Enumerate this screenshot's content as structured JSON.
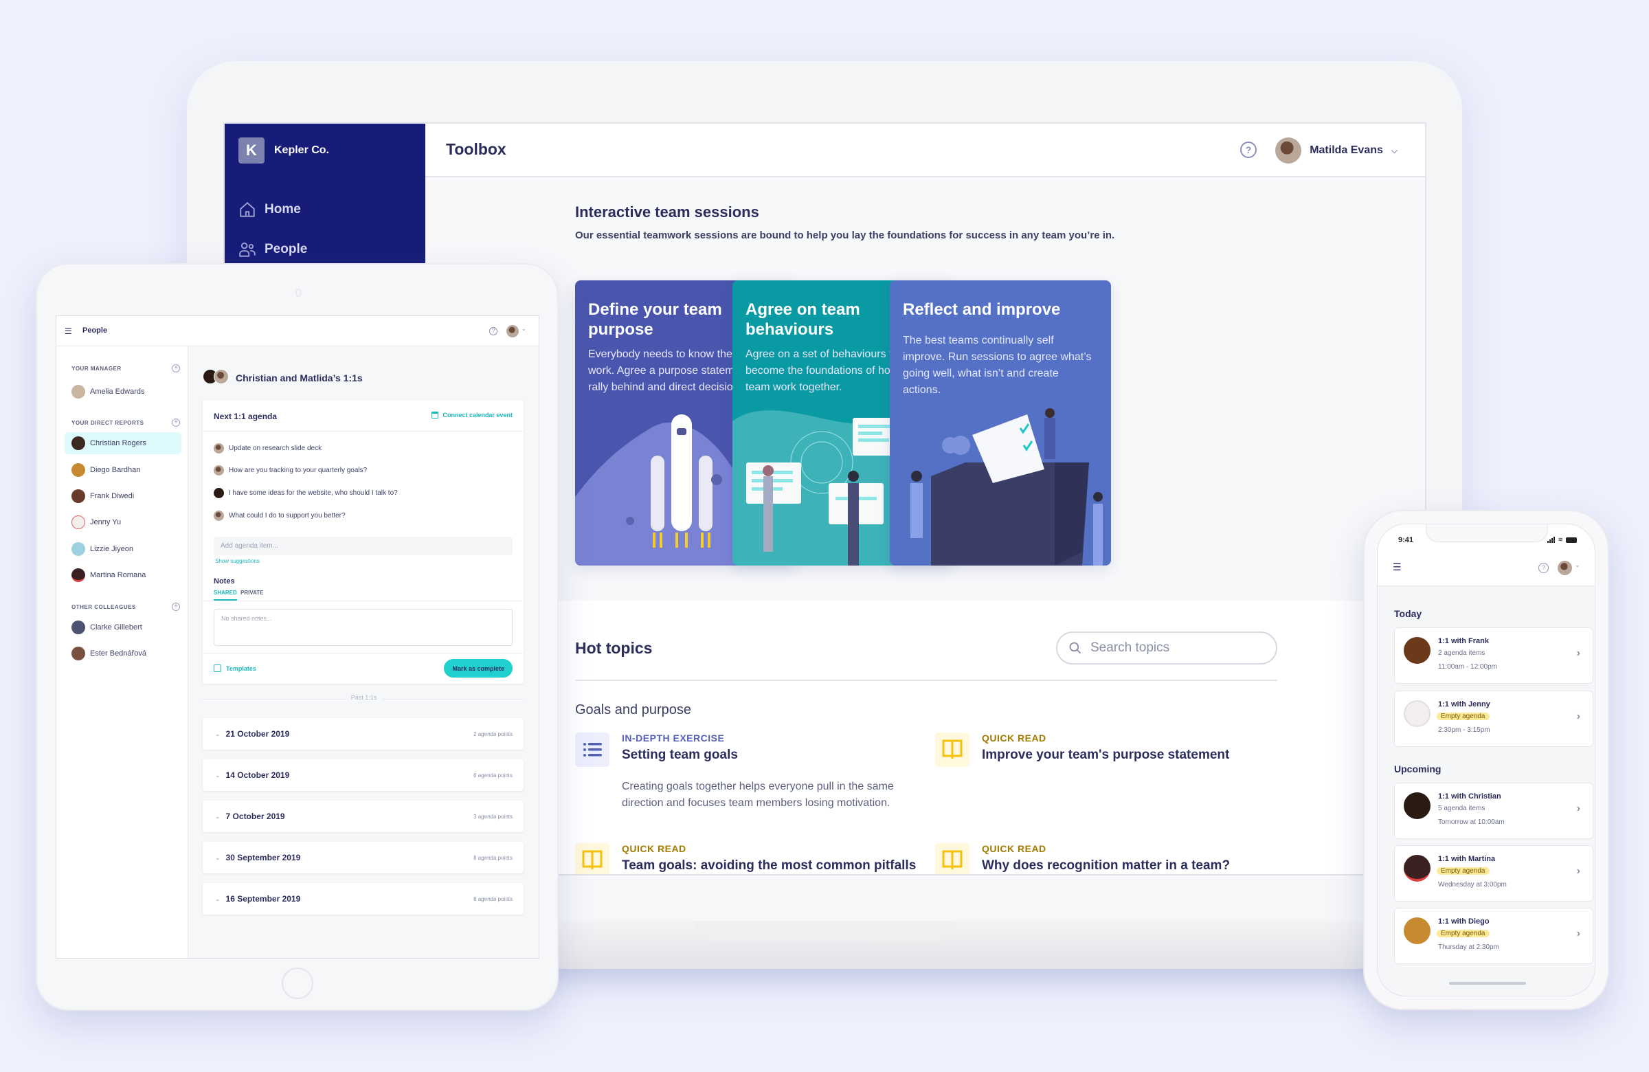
{
  "laptop": {
    "company": {
      "initial": "K",
      "name": "Kepler Co."
    },
    "nav": [
      {
        "label": "Home",
        "icon": "home-icon"
      },
      {
        "label": "People",
        "icon": "people-icon"
      }
    ],
    "header": {
      "title": "Toolbox",
      "help_icon": "?",
      "user_name": "Matilda Evans"
    },
    "sessions": {
      "title": "Interactive team sessions",
      "subtitle": "Our essential teamwork sessions are bound to help you lay the foundations for success in any team you’re in.",
      "cards": [
        {
          "title": "Define your team purpose",
          "description": "Everybody needs to know their “why” at work. Agree a purpose statement to to rally behind and direct decision making.",
          "color": "#4a55ad"
        },
        {
          "title": "Agree on team behaviours",
          "description": "Agree on a set of behaviours that will become the foundations of how the team work together.",
          "color": "#0a9aa3"
        },
        {
          "title": "Reflect and improve",
          "description": "The best teams continually self improve. Run sessions to agree what’s going well, what isn’t and create actions.",
          "color": "#5471c6"
        }
      ]
    },
    "hot_topics": {
      "title": "Hot topics",
      "search_placeholder": "Search topics",
      "category": "Goals and purpose",
      "topics": [
        {
          "type": "IN-DEPTH EXERCISE",
          "title": "Setting team goals",
          "description": "Creating goals together helps everyone pull in the same direction and focuses team members losing motivation.",
          "icon": "list-icon"
        },
        {
          "type": "QUICK READ",
          "title": "Improve your team's purpose statement",
          "description": "",
          "icon": "book-icon"
        },
        {
          "type": "QUICK READ",
          "title": "Team goals: avoiding the most common pitfalls",
          "description": "",
          "icon": "book-icon"
        },
        {
          "type": "QUICK READ",
          "title": "Why does recognition matter in a team?",
          "description": "",
          "icon": "book-icon"
        }
      ]
    }
  },
  "tablet": {
    "header_title": "People",
    "sidebar": {
      "manager_label": "YOUR MANAGER",
      "manager": [
        "Amelia Edwards"
      ],
      "reports_label": "YOUR DIRECT REPORTS",
      "reports": [
        "Christian Rogers",
        "Diego Bardhan",
        "Frank Diwedi",
        "Jenny Yu",
        "Lizzie Jiyeon",
        "Martina Romana"
      ],
      "selected": "Christian Rogers",
      "colleagues_label": "OTHER COLLEAGUES",
      "colleagues": [
        "Clarke Gillebert",
        "Ester Bednářová"
      ]
    },
    "page_title": "Christian and Matlida’s 1:1s",
    "agenda": {
      "title": "Next 1:1 agenda",
      "calendar_link": "Connect calendar event",
      "items": [
        "Update on research slide deck",
        "How are you tracking to your quarterly goals?",
        "I have some ideas for the website, who should I talk to?",
        "What could I do to support you better?"
      ],
      "add_placeholder": "Add agenda item...",
      "suggestions_link": "Show suggestions",
      "notes_label": "Notes",
      "tabs": [
        "SHARED",
        "PRIVATE"
      ],
      "active_tab": "SHARED",
      "notes_placeholder": "No shared notes...",
      "templates_link": "Templates",
      "complete_button": "Mark as complete"
    },
    "past_label": "Past 1:1s",
    "past": [
      {
        "date": "21 October 2019",
        "count": "2 agenda points"
      },
      {
        "date": "14 October 2019",
        "count": "6 agenda points"
      },
      {
        "date": "7 October 2019",
        "count": "3 agenda points"
      },
      {
        "date": "30 September 2019",
        "count": "8 agenda points"
      },
      {
        "date": "16 September 2019",
        "count": "8 agenda points"
      }
    ]
  },
  "phone": {
    "time": "9:41",
    "today_label": "Today",
    "upcoming_label": "Upcoming",
    "today": [
      {
        "title": "1:1 with Frank",
        "status": "2 agenda items",
        "empty": false,
        "when": "11:00am - 12:00pm"
      },
      {
        "title": "1:1 with Jenny",
        "status": "Empty agenda",
        "empty": true,
        "when": "2:30pm - 3:15pm"
      }
    ],
    "upcoming": [
      {
        "title": "1:1 with Christian",
        "status": "5 agenda items",
        "empty": false,
        "when": "Tomorrow at 10:00am"
      },
      {
        "title": "1:1 with Martina",
        "status": "Empty agenda",
        "empty": true,
        "when": "Wednesday at 3:00pm"
      },
      {
        "title": "1:1 with Diego",
        "status": "Empty agenda",
        "empty": true,
        "when": "Thursday at 2:30pm"
      }
    ]
  },
  "colors": {
    "background": "#eef0fc",
    "sidebar": "#171c78",
    "accent_teal": "#1fd0cf",
    "quick_read": "#a37a00",
    "exercise": "#5560b8"
  }
}
